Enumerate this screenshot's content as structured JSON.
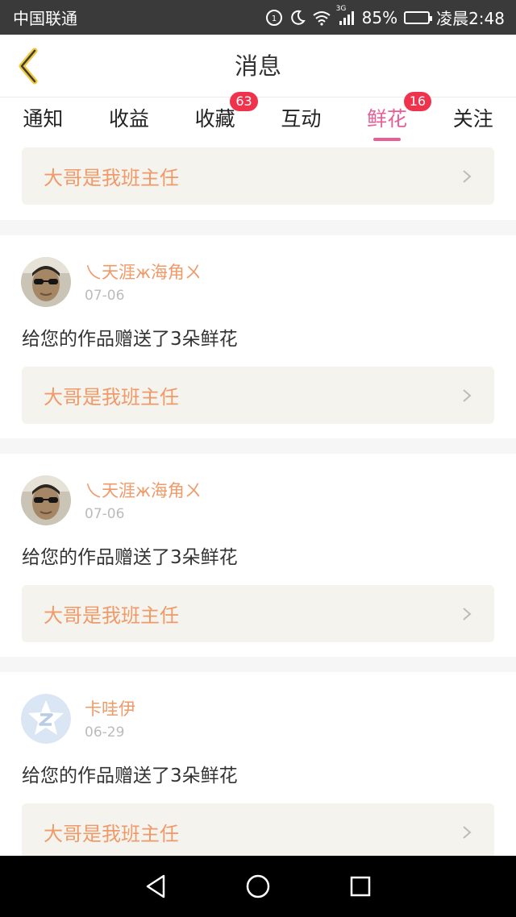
{
  "status_bar": {
    "carrier": "中国联通",
    "network": "3G",
    "battery": "85%",
    "battery_level": 0.85,
    "time": "凌晨2:48"
  },
  "header": {
    "title": "消息"
  },
  "tabs": [
    {
      "label": "通知",
      "badge": null,
      "active": false
    },
    {
      "label": "收益",
      "badge": null,
      "active": false
    },
    {
      "label": "收藏",
      "badge": "63",
      "active": false
    },
    {
      "label": "互动",
      "badge": null,
      "active": false
    },
    {
      "label": "鲜花",
      "badge": "16",
      "active": true
    },
    {
      "label": "关注",
      "badge": null,
      "active": false
    }
  ],
  "top_card": {
    "work_title": "大哥是我班主任"
  },
  "messages": [
    {
      "sender": "乀天涯ж海角ㄨ",
      "date": "07-06",
      "text": "给您的作品赠送了3朵鲜花",
      "work_title": "大哥是我班主任",
      "avatar": "photo-avatar"
    },
    {
      "sender": "乀天涯ж海角ㄨ",
      "date": "07-06",
      "text": "给您的作品赠送了3朵鲜花",
      "work_title": "大哥是我班主任",
      "avatar": "photo-avatar"
    },
    {
      "sender": "卡哇伊",
      "date": "06-29",
      "text": "给您的作品赠送了3朵鲜花",
      "work_title": "大哥是我班主任",
      "avatar": "default-qq-avatar"
    }
  ],
  "colors": {
    "accent": "#e75f95",
    "badge": "#f0334d",
    "work_title": "#ef9a68",
    "back_arrow": "#f0c83c"
  }
}
